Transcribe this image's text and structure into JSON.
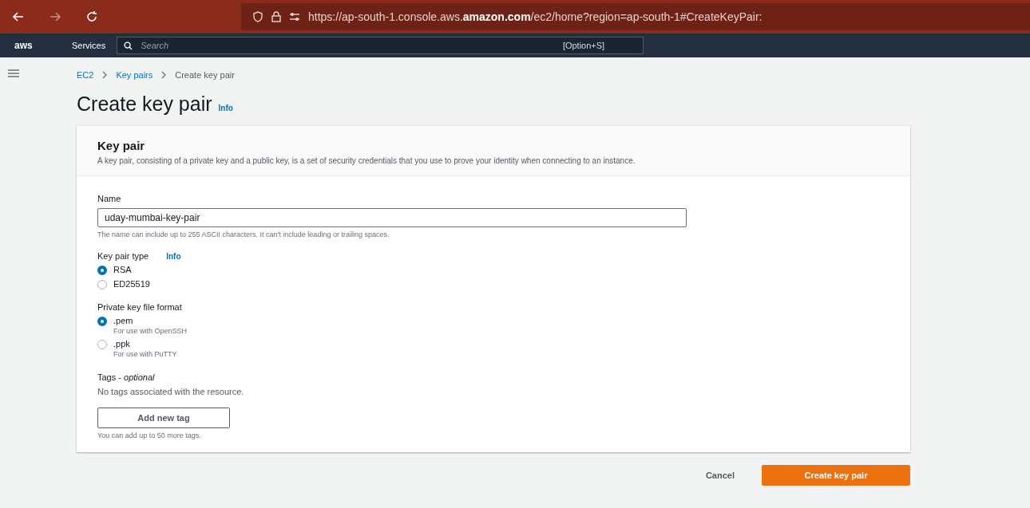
{
  "browser": {
    "url": "https://ap-south-1.console.aws.**amazon.com**/ec2/home?region=ap-south-1#CreateKeyPair:"
  },
  "console_nav": {
    "logo": "aws",
    "services": "Services",
    "search_placeholder": "Search",
    "shortcut": "[Option+S]"
  },
  "breadcrumbs": [
    {
      "label": "EC2",
      "link": true
    },
    {
      "label": "Key pairs",
      "link": true
    },
    {
      "label": "Create key pair",
      "link": false
    }
  ],
  "page_title": "Create key pair",
  "page_title_info": "Info",
  "panel": {
    "title": "Key pair",
    "description": "A key pair, consisting of a private key and a public key, is a set of security credentials that you use to prove your identity when connecting to an instance.",
    "name_label": "Name",
    "name_value": "uday-mumbai-key-pair",
    "name_hint": "The name can include up to 255 ASCII characters. It can't include leading or trailing spaces.",
    "type_label": "Key pair type",
    "type_info": "Info",
    "types": [
      {
        "label": "RSA",
        "selected": true
      },
      {
        "label": "ED25519",
        "selected": false
      }
    ],
    "format_label": "Private key file format",
    "formats": [
      {
        "label": ".pem",
        "hint": "For use with OpenSSH",
        "selected": true
      },
      {
        "label": ".ppk",
        "hint": "For use with PuTTY",
        "selected": false
      }
    ],
    "tags_label": "Tags - ",
    "tags_optional": "optional",
    "tags_empty": "No tags associated with the resource.",
    "add_tag": "Add new tag",
    "tags_hint": "You can add up to 50 more tags."
  },
  "actions": {
    "cancel": "Cancel",
    "submit": "Create key pair"
  }
}
